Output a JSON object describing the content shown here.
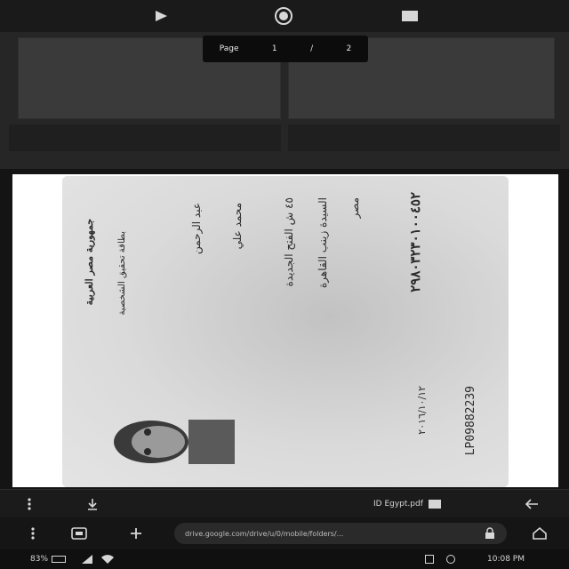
{
  "top_toolbar": {
    "play_icon": "play-icon",
    "record_icon": "record-icon",
    "screen_icon": "screen-icon"
  },
  "page_indicator": {
    "label": "Page",
    "current": "1",
    "separator": "/",
    "total": "2"
  },
  "document": {
    "id_number_top": "٢٩٨٠٣٢٣٠١٠٠٤٥٢",
    "name_line_1": "عبد الرحمن",
    "name_line_2": "محمد علي",
    "address_line_1": "٤٥ ش الفتح الجديدة",
    "address_line_2": "السيدة زينب القاهرة",
    "address_line_3": "مصر",
    "issuer_title": "جمهورية مصر العربية",
    "issuer_subtitle": "بطاقة تحقيق الشخصية",
    "issue_date": "٢٠١٦/١٠/١٢",
    "serial_number": "LP09882239"
  },
  "viewer_toolbar": {
    "back_icon": "arrow-left-icon",
    "file_label": "ID Egypt.pdf",
    "download_icon": "download-icon",
    "more_icon": "more-vertical-icon"
  },
  "browser": {
    "url": "drive.google.com/drive/u/0/mobile/folders/...",
    "home_icon": "home-icon",
    "new_tab_icon": "plus-icon",
    "tabs_icon": "tabs-icon",
    "menu_icon": "more-vertical-icon"
  },
  "status_bar": {
    "time": "10:08 PM",
    "battery": "83%",
    "signal_icon": "signal-icon",
    "wifi_icon": "wifi-icon"
  },
  "colors": {
    "background": "#141414",
    "toolbar": "#1b1b1b",
    "card": "#d6d6d6",
    "text_dark": "#2a2a2a"
  }
}
